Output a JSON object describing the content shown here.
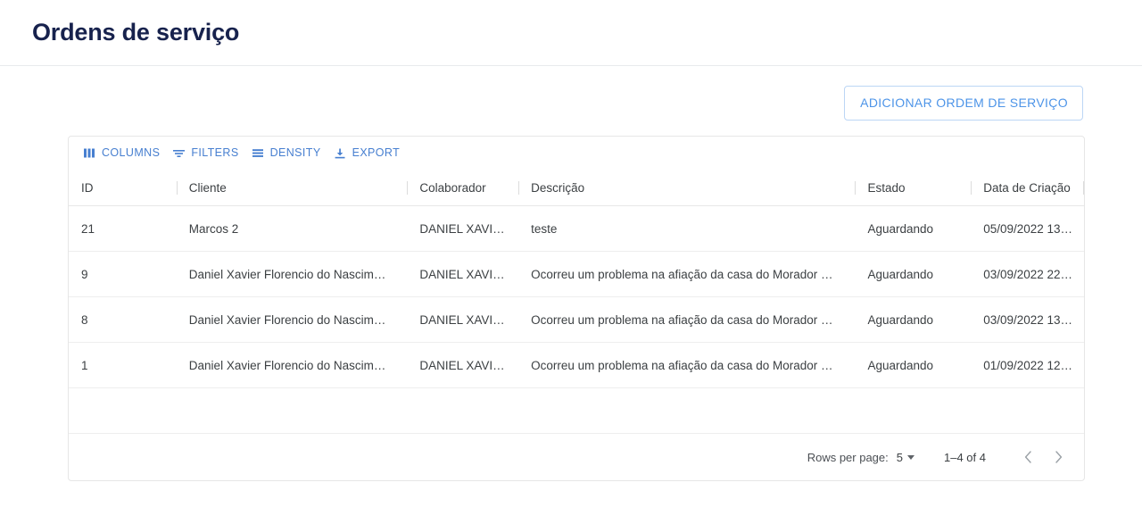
{
  "header": {
    "title": "Ordens de serviço"
  },
  "actions": {
    "add_label": "ADICIONAR ORDEM DE SERVIÇO"
  },
  "toolbar": {
    "columns_label": "COLUMNS",
    "filters_label": "FILTERS",
    "density_label": "DENSITY",
    "export_label": "EXPORT",
    "icons": {
      "columns": "columns-icon",
      "filters": "filters-icon",
      "density": "density-icon",
      "export": "export-icon"
    }
  },
  "grid": {
    "columns": [
      {
        "key": "id",
        "label": "ID"
      },
      {
        "key": "cliente",
        "label": "Cliente"
      },
      {
        "key": "colaborador",
        "label": "Colaborador"
      },
      {
        "key": "descricao",
        "label": "Descrição"
      },
      {
        "key": "estado",
        "label": "Estado"
      },
      {
        "key": "data",
        "label": "Data de Criação"
      }
    ],
    "rows": [
      {
        "id": "21",
        "cliente": "Marcos 2",
        "colaborador": "DANIEL XAVI…",
        "descricao": "teste",
        "estado": "Aguardando",
        "data": "05/09/2022 13…"
      },
      {
        "id": "9",
        "cliente": "Daniel Xavier Florencio do Nascim…",
        "colaborador": "DANIEL XAVI…",
        "descricao": "Ocorreu um problema na afiação da casa do Morador …",
        "estado": "Aguardando",
        "data": "03/09/2022 22…"
      },
      {
        "id": "8",
        "cliente": "Daniel Xavier Florencio do Nascim…",
        "colaborador": "DANIEL XAVI…",
        "descricao": "Ocorreu um problema na afiação da casa do Morador …",
        "estado": "Aguardando",
        "data": "03/09/2022 13…"
      },
      {
        "id": "1",
        "cliente": "Daniel Xavier Florencio do Nascim…",
        "colaborador": "DANIEL XAVI…",
        "descricao": "Ocorreu um problema na afiação da casa do Morador …",
        "estado": "Aguardando",
        "data": "01/09/2022 12…"
      }
    ]
  },
  "pagination": {
    "rows_per_page_label": "Rows per page:",
    "rows_per_page_value": "5",
    "range_label": "1–4 of 4",
    "prev_icon": "chevron-left-icon",
    "next_icon": "chevron-right-icon"
  },
  "colors": {
    "accent": "#477fd0",
    "title": "#17224d",
    "button_border": "#bcd6f5",
    "button_text": "#4d94e8",
    "text": "#3c4043"
  }
}
